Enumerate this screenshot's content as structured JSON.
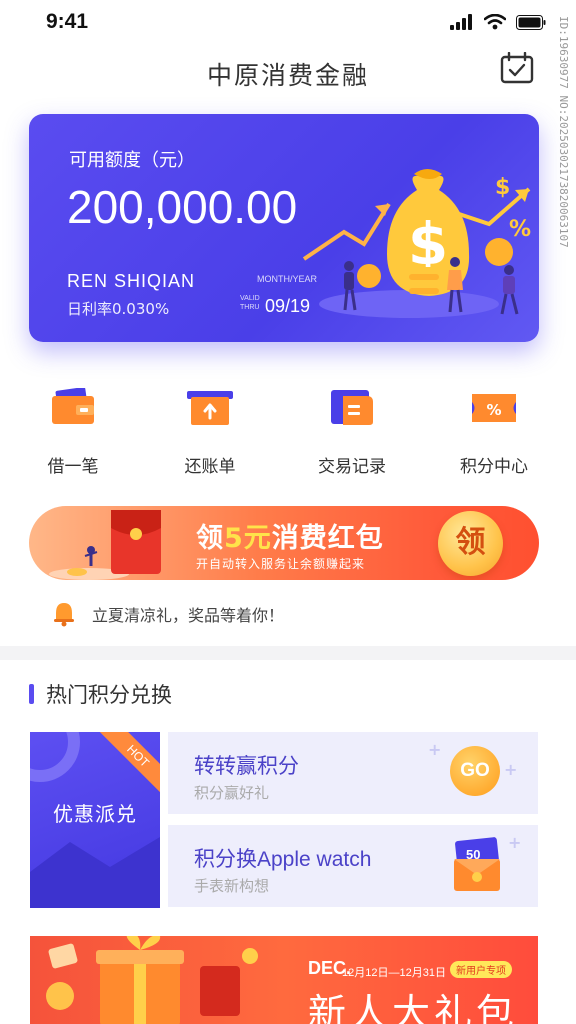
{
  "status_bar": {
    "time": "9:41"
  },
  "header": {
    "title": "中原消费金融",
    "icons": [
      "calendar-check-icon"
    ]
  },
  "watermark": {
    "text": "ID:19630977 NO:20250302173820063107"
  },
  "card": {
    "label": "可用额度（元）",
    "amount": "200,000.00",
    "name": "REN SHIQIAN",
    "rate": "日利率0.030%",
    "month_label": "MONTH/YEAR",
    "valid_label": "VALID THRU",
    "date": "09/19",
    "colors": {
      "bg": "#4e42ec",
      "accent": "#ffc52e"
    }
  },
  "menu": [
    {
      "label": "借一笔",
      "icon": "wallet-icon"
    },
    {
      "label": "还账单",
      "icon": "repay-box-icon"
    },
    {
      "label": "交易记录",
      "icon": "record-icon"
    },
    {
      "label": "积分中心",
      "icon": "points-ticket-icon"
    }
  ],
  "promo_banner": {
    "title_pre": "领",
    "title_highlight": "5元",
    "title_post": "消费红包",
    "subtitle": "开自动转入服务让余额赚起来",
    "button": "领"
  },
  "notice": {
    "text": "立夏清凉礼，奖品等着你！",
    "icon": "bell-icon"
  },
  "section": {
    "title": "热门积分兑换"
  },
  "exchange": {
    "promo_label": "优惠派兑",
    "hot_label": "HOT",
    "items": [
      {
        "title": "转转赢积分",
        "subtitle": "积分赢好礼",
        "badge": "GO"
      },
      {
        "title": "积分换Apple watch",
        "subtitle": "手表新构想",
        "badge": "50"
      }
    ]
  },
  "bottom_banner": {
    "dec": "DEC.",
    "range": "12月12日—12月31日",
    "badge": "新用户专项",
    "title": "新人大礼包"
  }
}
